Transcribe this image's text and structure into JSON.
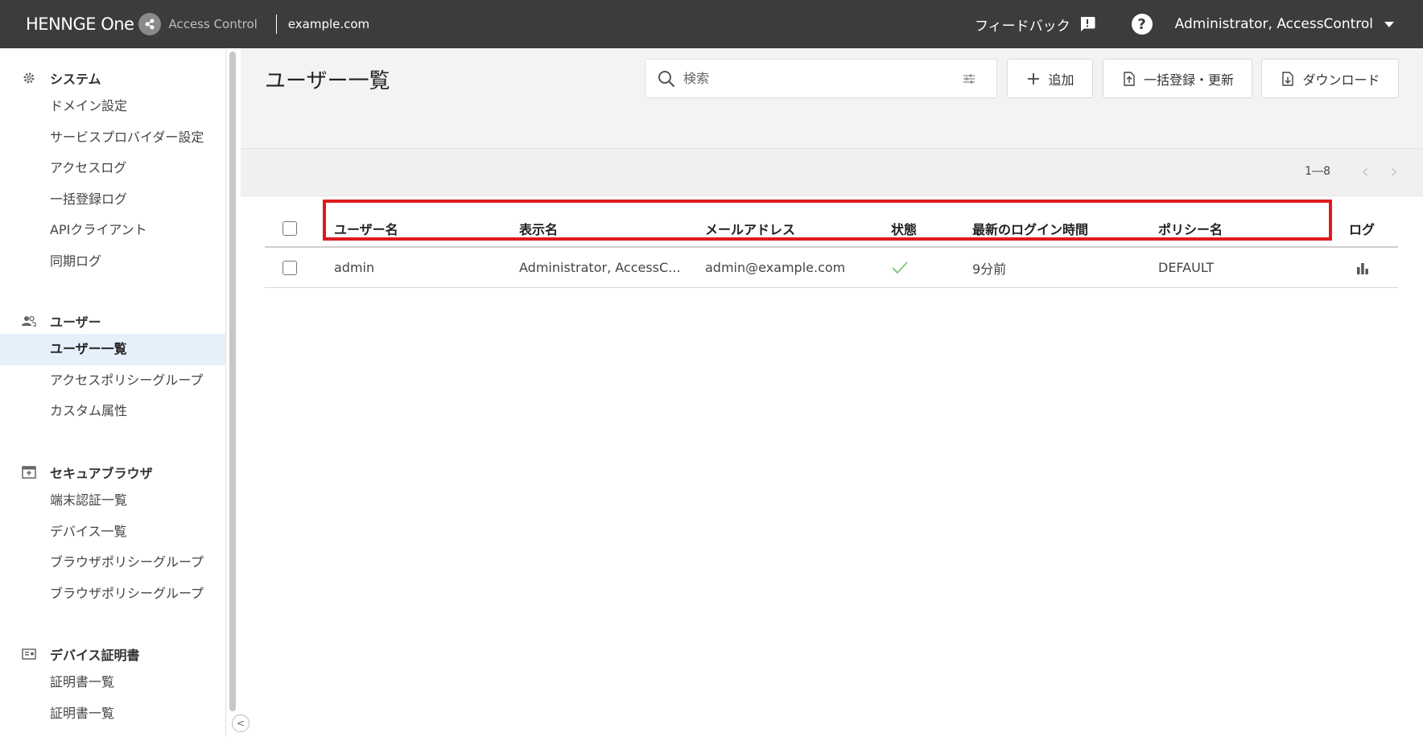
{
  "topbar": {
    "brand": "HENNGE One",
    "product": "Access Control",
    "domain": "example.com",
    "feedback_label": "フィードバック",
    "feedback_icon": "feedback-icon",
    "help_icon": "help-icon",
    "user_label": "Administrator, AccessControl"
  },
  "sidebar": {
    "sections": [
      {
        "title": "システム",
        "icon": "gear-icon",
        "items": [
          "ドメイン設定",
          "サービスプロバイダー設定",
          "アクセスログ",
          "一括登録ログ",
          "APIクライアント",
          "同期ログ"
        ]
      },
      {
        "title": "ユーザー",
        "icon": "users-icon",
        "items": [
          "ユーザー一覧",
          "アクセスポリシーグループ",
          "カスタム属性"
        ]
      },
      {
        "title": "セキュアブラウザ",
        "icon": "browser-icon",
        "items": [
          "端末認証一覧",
          "デバイス一覧",
          "ブラウザポリシーグループ",
          "ブラウザポリシーグループ"
        ]
      },
      {
        "title": "デバイス証明書",
        "icon": "certificate-icon",
        "items": [
          "証明書一覧",
          "証明書一覧"
        ]
      }
    ],
    "active_item": "ユーザー一覧"
  },
  "main": {
    "title": "ユーザー一覧",
    "search": {
      "placeholder": "検索"
    },
    "buttons": {
      "add": "追加",
      "bulk": "一括登録・更新",
      "download": "ダウンロード"
    },
    "pager": {
      "range": "1―8"
    },
    "table": {
      "columns": [
        "ユーザー名",
        "表示名",
        "メールアドレス",
        "状態",
        "最新のログイン時間",
        "ポリシー名",
        "ログ"
      ],
      "rows": [
        {
          "username": "admin",
          "display_name": "Administrator, AccessC...",
          "email": "admin@example.com",
          "status": "active",
          "last_login": "9分前",
          "policy": "DEFAULT",
          "log_icon": "bar-chart-icon"
        }
      ]
    }
  },
  "colors": {
    "topbar": "#3c3c3c",
    "highlight": "#e0191e",
    "active_bg": "#e6f0fb",
    "status_ok": "#6cc06c"
  }
}
